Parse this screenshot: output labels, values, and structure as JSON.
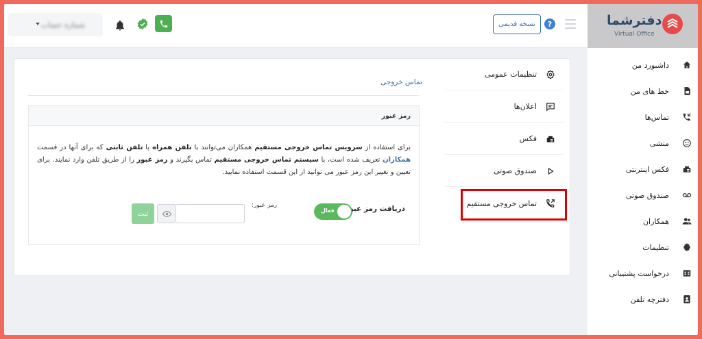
{
  "header": {
    "account_name": "شماره حساب",
    "old_version_label": "نسخه قدیمی",
    "help_symbol": "?"
  },
  "logo": {
    "brand": "دفترشما",
    "sub": "Virtual Office"
  },
  "sidebar": {
    "items": [
      {
        "label": "داشبورد من",
        "icon": "home-icon"
      },
      {
        "label": "خط های من",
        "icon": "sim-card-icon"
      },
      {
        "label": "تماس‌ها",
        "icon": "call-log-icon"
      },
      {
        "label": "منشی",
        "icon": "assistant-icon"
      },
      {
        "label": "فکس اینترنتی",
        "icon": "fax-icon"
      },
      {
        "label": "صندوق صوتی",
        "icon": "voicemail-icon"
      },
      {
        "label": "همکاران",
        "icon": "users-icon"
      },
      {
        "label": "تنظیمات",
        "icon": "settings-icon"
      },
      {
        "label": "درخواست پشتیبانی",
        "icon": "support-icon"
      },
      {
        "label": "دفترچه تلفن",
        "icon": "phonebook-icon"
      }
    ]
  },
  "settings_menu": {
    "items": [
      {
        "label": "تنظیمات عمومی",
        "icon": "gear-icon"
      },
      {
        "label": "اعلان‌ها",
        "icon": "message-icon"
      },
      {
        "label": "فکس",
        "icon": "fax-icon"
      },
      {
        "label": "صندوق صوتی",
        "icon": "play-icon"
      },
      {
        "label": "تماس خروجی مستقیم",
        "icon": "outgoing-call-icon"
      }
    ]
  },
  "content": {
    "section_title": "تماس خروجی",
    "panel_title": "رمز عبور",
    "desc": {
      "p1": "برای استفاده از ",
      "b1": "سرویس تماس خروجی مستقیم",
      "p2": " همکاران می‌توانند با ",
      "b2": "تلفن همراه",
      "p3": " یا ",
      "b3": "تلفن ثابتی",
      "p4": " که برای آنها در قسمت ",
      "link": "همکاران",
      "p5": " تعریف شده است، با ",
      "b4": "سیستم تماس خروجی مستقیم",
      "p6": " تماس بگیرند و ",
      "b5": "رمز عبور",
      "p7": " را از طریق تلفن وارد نمایند. برای تعیین و تغییر این رمز عبور می توانید از این قسمت استفاده نمایید."
    },
    "receive_pw_label": "دریافت رمز عبور:",
    "toggle_state": "فعال",
    "pw_label": "رمز عبور:",
    "pw_value": "",
    "submit_label": "ثبت"
  },
  "colors": {
    "accent": "#3b6ea5",
    "success": "#5cb85c",
    "highlight": "#e10000",
    "brand_red": "#e84a4a"
  }
}
